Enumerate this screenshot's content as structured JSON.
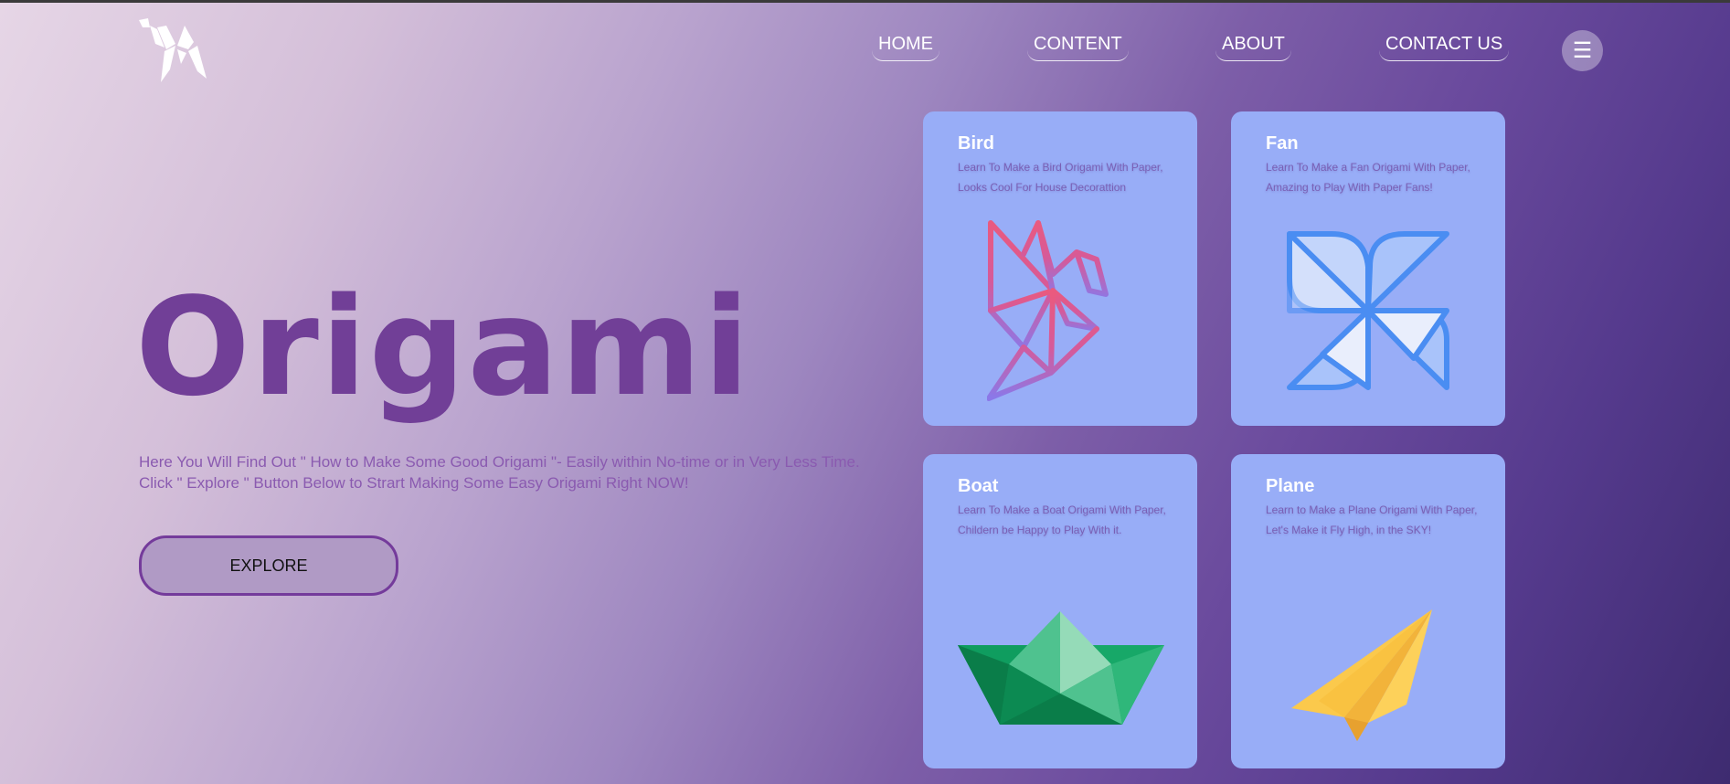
{
  "nav": {
    "links": [
      "HOME",
      "CONTENT",
      "ABOUT",
      "CONTACT US"
    ],
    "menu_icon": "☰"
  },
  "hero": {
    "title": "Origami",
    "description": [
      "Here You Will Find Out \" How to Make Some Good Origami \"- Easily within No-time or in Very Less Time.",
      "Click \" Explore \" Button Below to Strart Making Some Easy Origami Right NOW!"
    ],
    "button_label": "EXPLORE"
  },
  "cards": [
    {
      "title": "Bird",
      "description": "Learn To Make a Bird Origami With Paper, Looks Cool For House Decorattion",
      "icon": "origami-bird-icon"
    },
    {
      "title": "Fan",
      "description": "Learn To Make a Fan Origami With Paper, Amazing to Play With Paper Fans!",
      "icon": "pinwheel-icon"
    },
    {
      "title": "Boat",
      "description": "Learn To Make a Boat Origami With Paper, Childern be Happy to Play With it.",
      "icon": "paper-boat-icon"
    },
    {
      "title": "Plane",
      "description": "Learn to Make a Plane Origami With Paper, Let's Make it Fly High, in the SKY!",
      "icon": "paper-plane-icon"
    }
  ],
  "colors": {
    "accent": "#713f97",
    "card_bg": "#98adf7",
    "button_bg": "#b09ac5"
  }
}
